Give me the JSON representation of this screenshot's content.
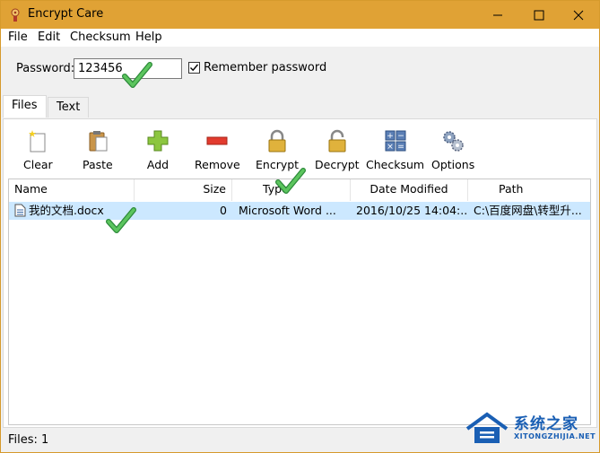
{
  "window": {
    "title": "Encrypt Care"
  },
  "menu": [
    "File",
    "Edit",
    "Checksum",
    "Help"
  ],
  "password": {
    "label": "Password:",
    "value": "123456",
    "remember_label": "Remember password",
    "remember_checked": true
  },
  "tabs": [
    "Files",
    "Text"
  ],
  "toolbar": [
    "Clear",
    "Paste",
    "Add",
    "Remove",
    "Encrypt",
    "Decrypt",
    "Checksum",
    "Options"
  ],
  "columns": [
    "Name",
    "Size",
    "Type",
    "Date Modified",
    "Path"
  ],
  "rows": [
    {
      "name": "我的文档.docx",
      "size": "0",
      "type": "Microsoft Word ...",
      "date": "2016/10/25 14:04:...",
      "path": "C:\\百度网盘\\转型升..."
    }
  ],
  "status": "Files: 1",
  "watermark": {
    "text": "系统之家",
    "sub": "XITONGZHIJIA.NET"
  },
  "colors": {
    "titlebar": "#e0a235",
    "selection": "#cce8ff",
    "checkmark": "#3aa64a"
  }
}
